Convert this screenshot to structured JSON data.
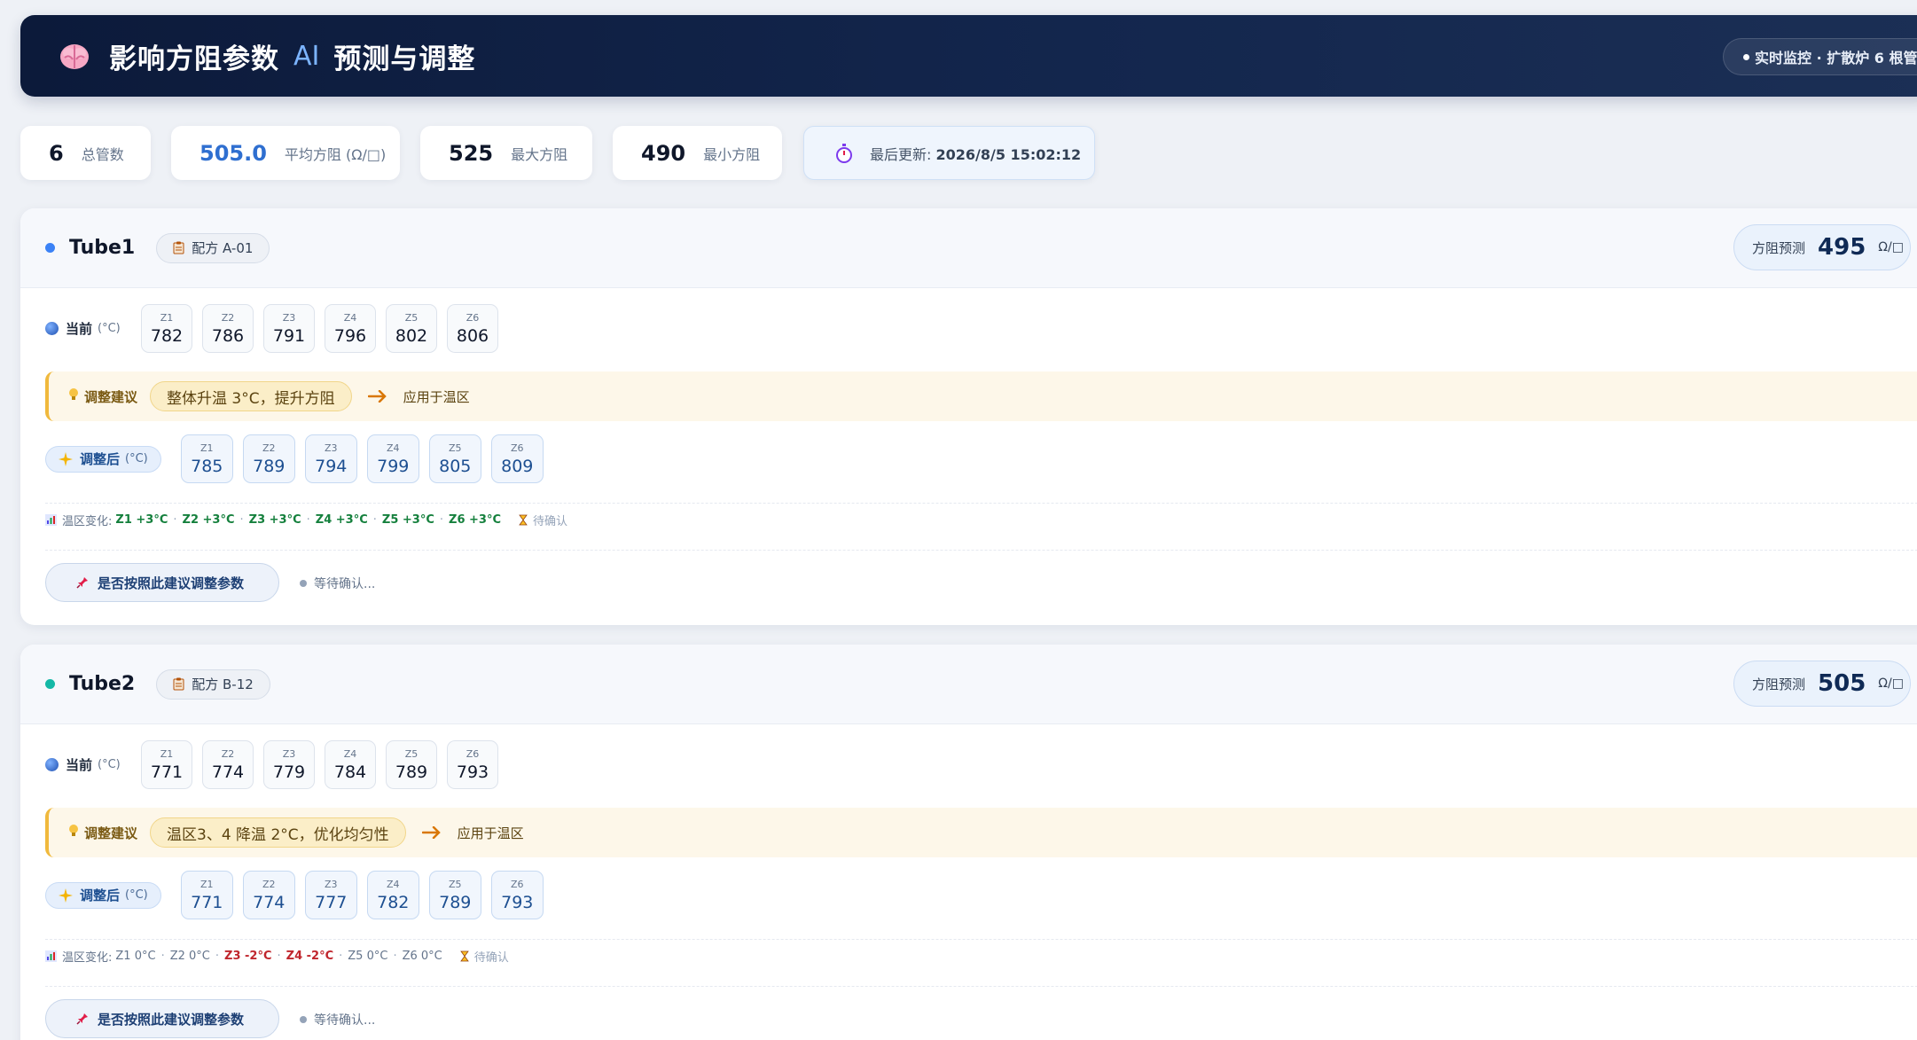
{
  "header": {
    "title": "影响方阻参数",
    "ai": "AI",
    "title2": "预测与调整",
    "badge": "实时监控 · 扩散炉 6 根管"
  },
  "stats": {
    "total_tubes": {
      "value": "6",
      "label": "总管数"
    },
    "avg": {
      "value": "505.0",
      "label": "平均方阻 (Ω/□)"
    },
    "max": {
      "value": "525",
      "label": "最大方阻"
    },
    "min": {
      "value": "490",
      "label": "最小方阻"
    },
    "update": {
      "label": "最后更新:",
      "time": "2026/8/5 15:02:12"
    }
  },
  "labels": {
    "current": "当前",
    "unit_c": "(°C)",
    "advice": "调整建议",
    "apply": "应用于温区",
    "adjusted": "调整后",
    "delta_prefix": "温区变化:",
    "pending": "待确认",
    "confirm": "是否按照此建议调整参数",
    "waiting": "等待确认...",
    "pred_label": "方阻预测",
    "pred_unit": "Ω/□"
  },
  "tubes": [
    {
      "name": "Tube1",
      "dot_color": "#3b82f6",
      "recipe": "配方 A-01",
      "prediction": "495",
      "zone_names": [
        "Z1",
        "Z2",
        "Z3",
        "Z4",
        "Z5",
        "Z6"
      ],
      "current": [
        "782",
        "786",
        "791",
        "796",
        "802",
        "806"
      ],
      "advice": "整体升温 3°C，提升方阻",
      "adjusted": [
        "785",
        "789",
        "794",
        "799",
        "805",
        "809"
      ],
      "deltas": [
        "Z1 +3°C",
        "Z2 +3°C",
        "Z3 +3°C",
        "Z4 +3°C",
        "Z5 +3°C",
        "Z6 +3°C"
      ],
      "delta_kind": [
        "up",
        "up",
        "up",
        "up",
        "up",
        "up"
      ]
    },
    {
      "name": "Tube2",
      "dot_color": "#14b8a6",
      "recipe": "配方 B-12",
      "prediction": "505",
      "zone_names": [
        "Z1",
        "Z2",
        "Z3",
        "Z4",
        "Z5",
        "Z6"
      ],
      "current": [
        "771",
        "774",
        "779",
        "784",
        "789",
        "793"
      ],
      "advice": "温区3、4 降温 2°C，优化均匀性",
      "adjusted": [
        "771",
        "774",
        "777",
        "782",
        "789",
        "793"
      ],
      "deltas": [
        "Z1 0°C",
        "Z2 0°C",
        "Z3 -2°C",
        "Z4 -2°C",
        "Z5 0°C",
        "Z6 0°C"
      ],
      "delta_kind": [
        "zero",
        "zero",
        "down",
        "down",
        "zero",
        "zero"
      ]
    }
  ]
}
